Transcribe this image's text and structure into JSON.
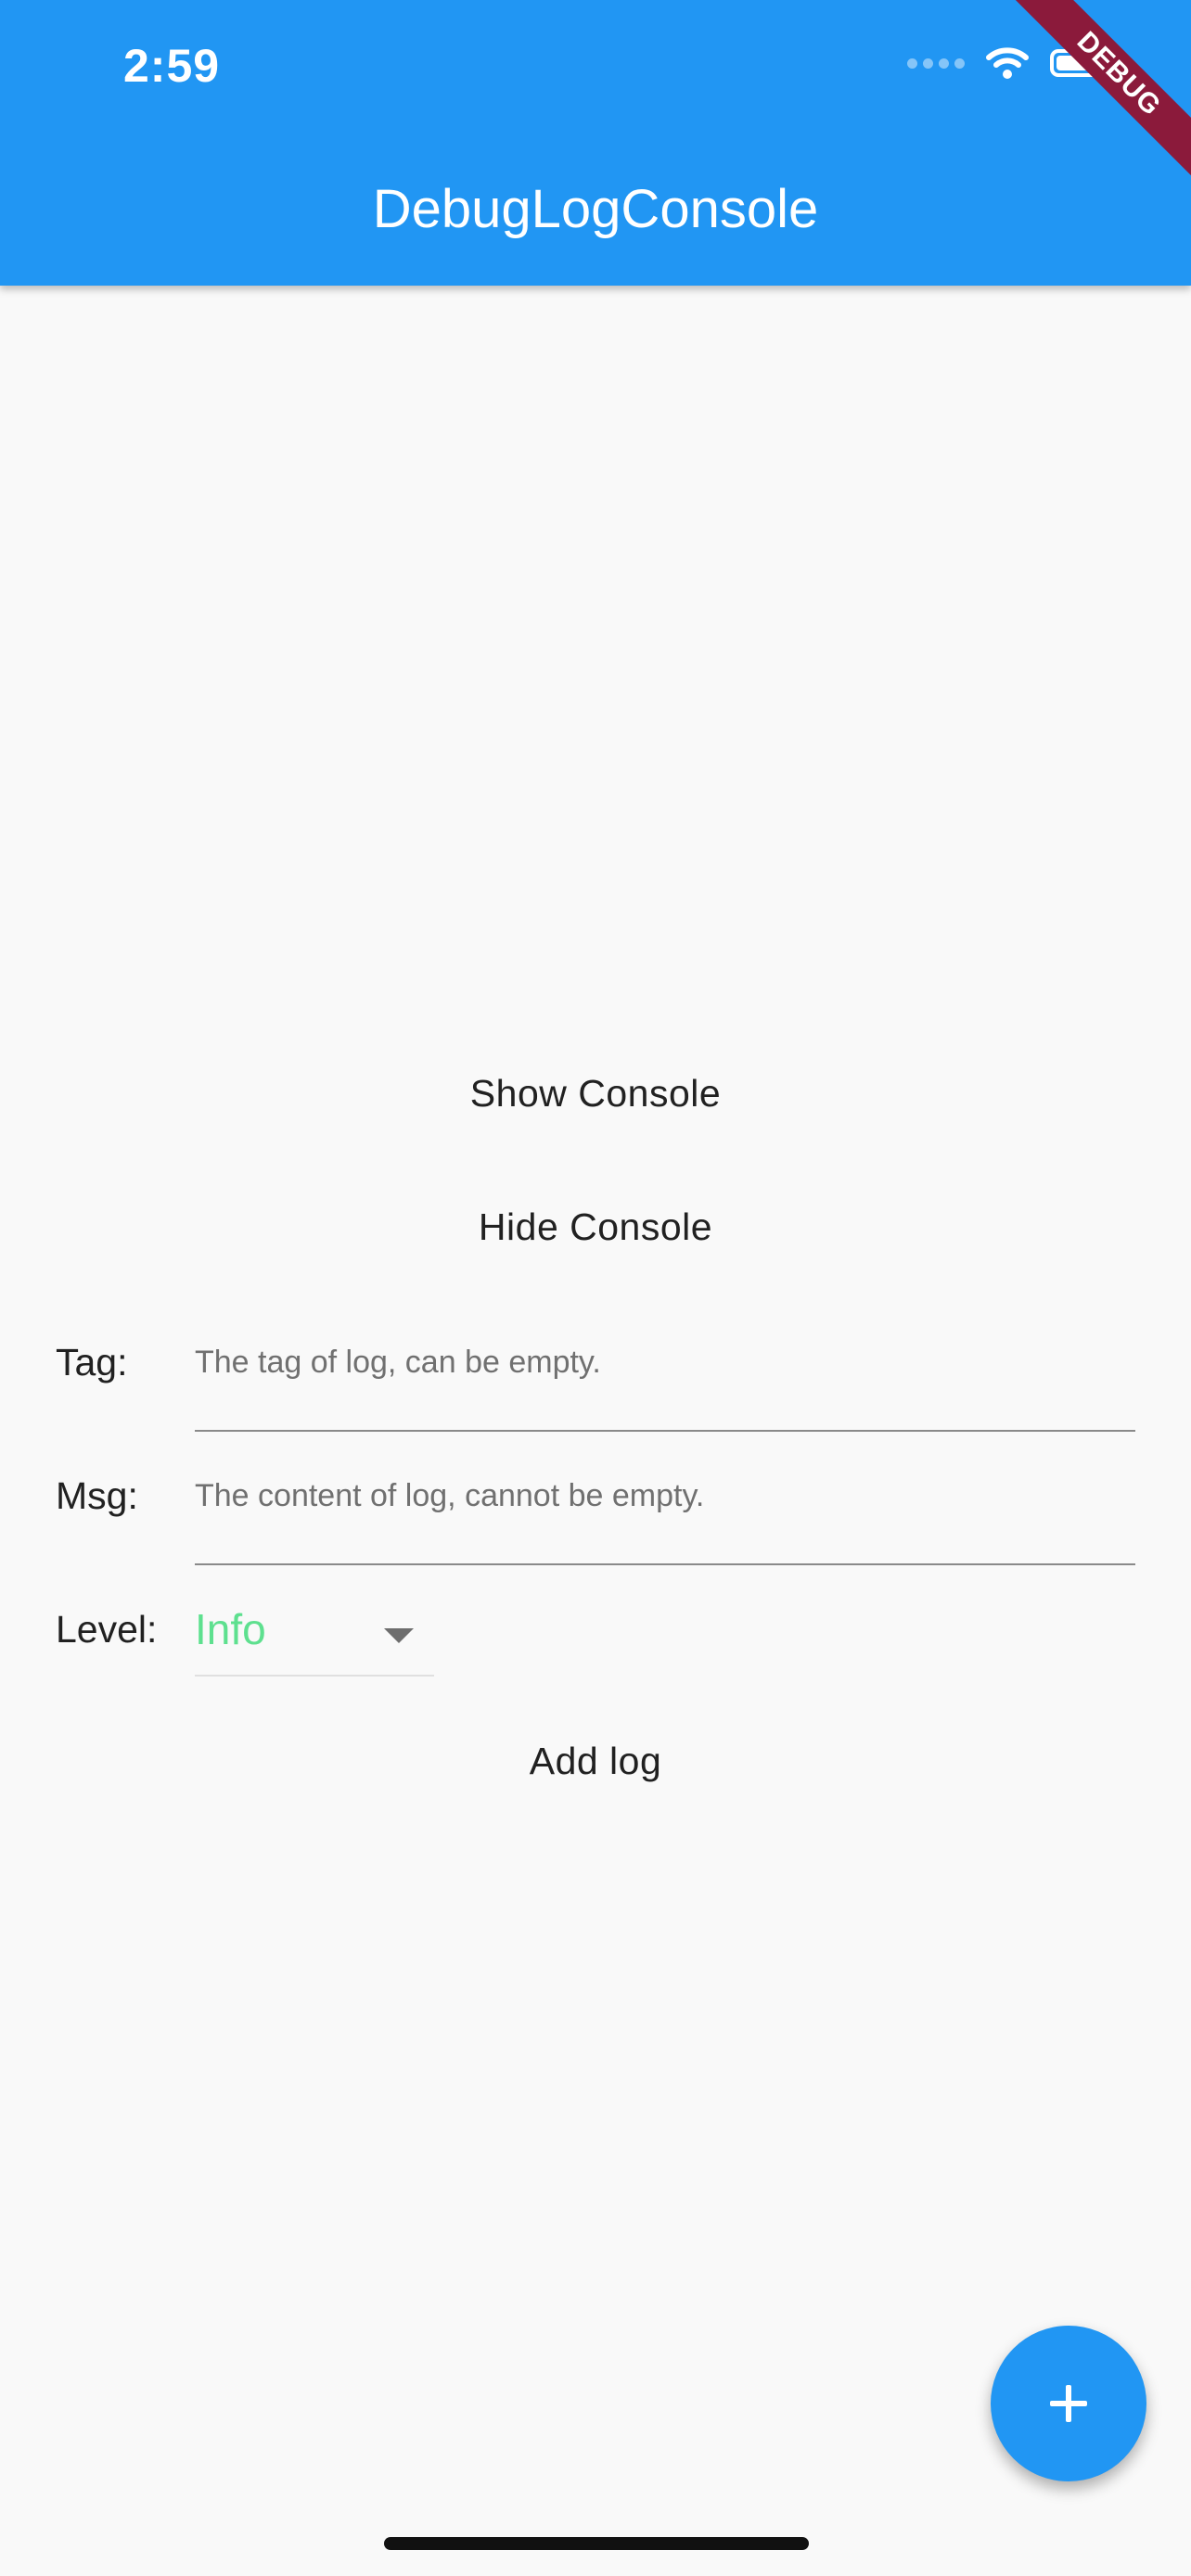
{
  "status_bar": {
    "time": "2:59",
    "icons": [
      "cellular-signal-icon",
      "wifi-icon",
      "battery-icon"
    ]
  },
  "app_bar": {
    "title": "DebugLogConsole",
    "color": "#2196f3"
  },
  "debug_banner": "DEBUG",
  "actions": {
    "show_console": "Show Console",
    "hide_console": "Hide Console",
    "add_log": "Add log"
  },
  "form": {
    "tag": {
      "label": "Tag:",
      "placeholder": "The tag of log, can be empty.",
      "value": ""
    },
    "msg": {
      "label": "Msg:",
      "placeholder": "The content of log, cannot be empty.",
      "value": ""
    },
    "level": {
      "label": "Level:",
      "selected": "Info",
      "selected_color": "#5ee08f"
    }
  },
  "fab": {
    "icon": "plus-icon",
    "color": "#2196f3"
  }
}
